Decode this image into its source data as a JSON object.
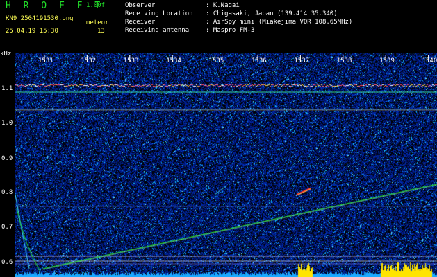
{
  "app": {
    "title": "H R O F F T",
    "version": "1.00f",
    "filename": "KN9_2504191530.png",
    "meteor_label": "meteor",
    "datetime": "25.04.19 15:30",
    "meteor_count": "13"
  },
  "info": [
    {
      "label": "Observer",
      "value": ": K.Nagai"
    },
    {
      "label": "Receiving Location",
      "value": ": Chigasaki, Japan (139.414 35.340)"
    },
    {
      "label": "Receiver",
      "value": ": AirSpy mini (Miakejima VOR 108.65MHz)"
    },
    {
      "label": "Receiving antenna",
      "value": ": Maspro FM-3"
    }
  ],
  "axis": {
    "unit": "kHz",
    "y_ticks": [
      "1.1",
      "1.0",
      "0.9",
      "0.8",
      "0.7",
      "0.6"
    ],
    "x_ticks": [
      "1531",
      "1532",
      "1533",
      "1534",
      "1535",
      "1536",
      "1537",
      "1538",
      "1539",
      "1540"
    ]
  },
  "colors": {
    "signal": "#22e02a",
    "noise": "#0a1d8a",
    "background": "#000000",
    "meteor": "#ff3030",
    "spectrum": "#1aa8ff",
    "spectrum_peak": "#ffe400"
  }
}
